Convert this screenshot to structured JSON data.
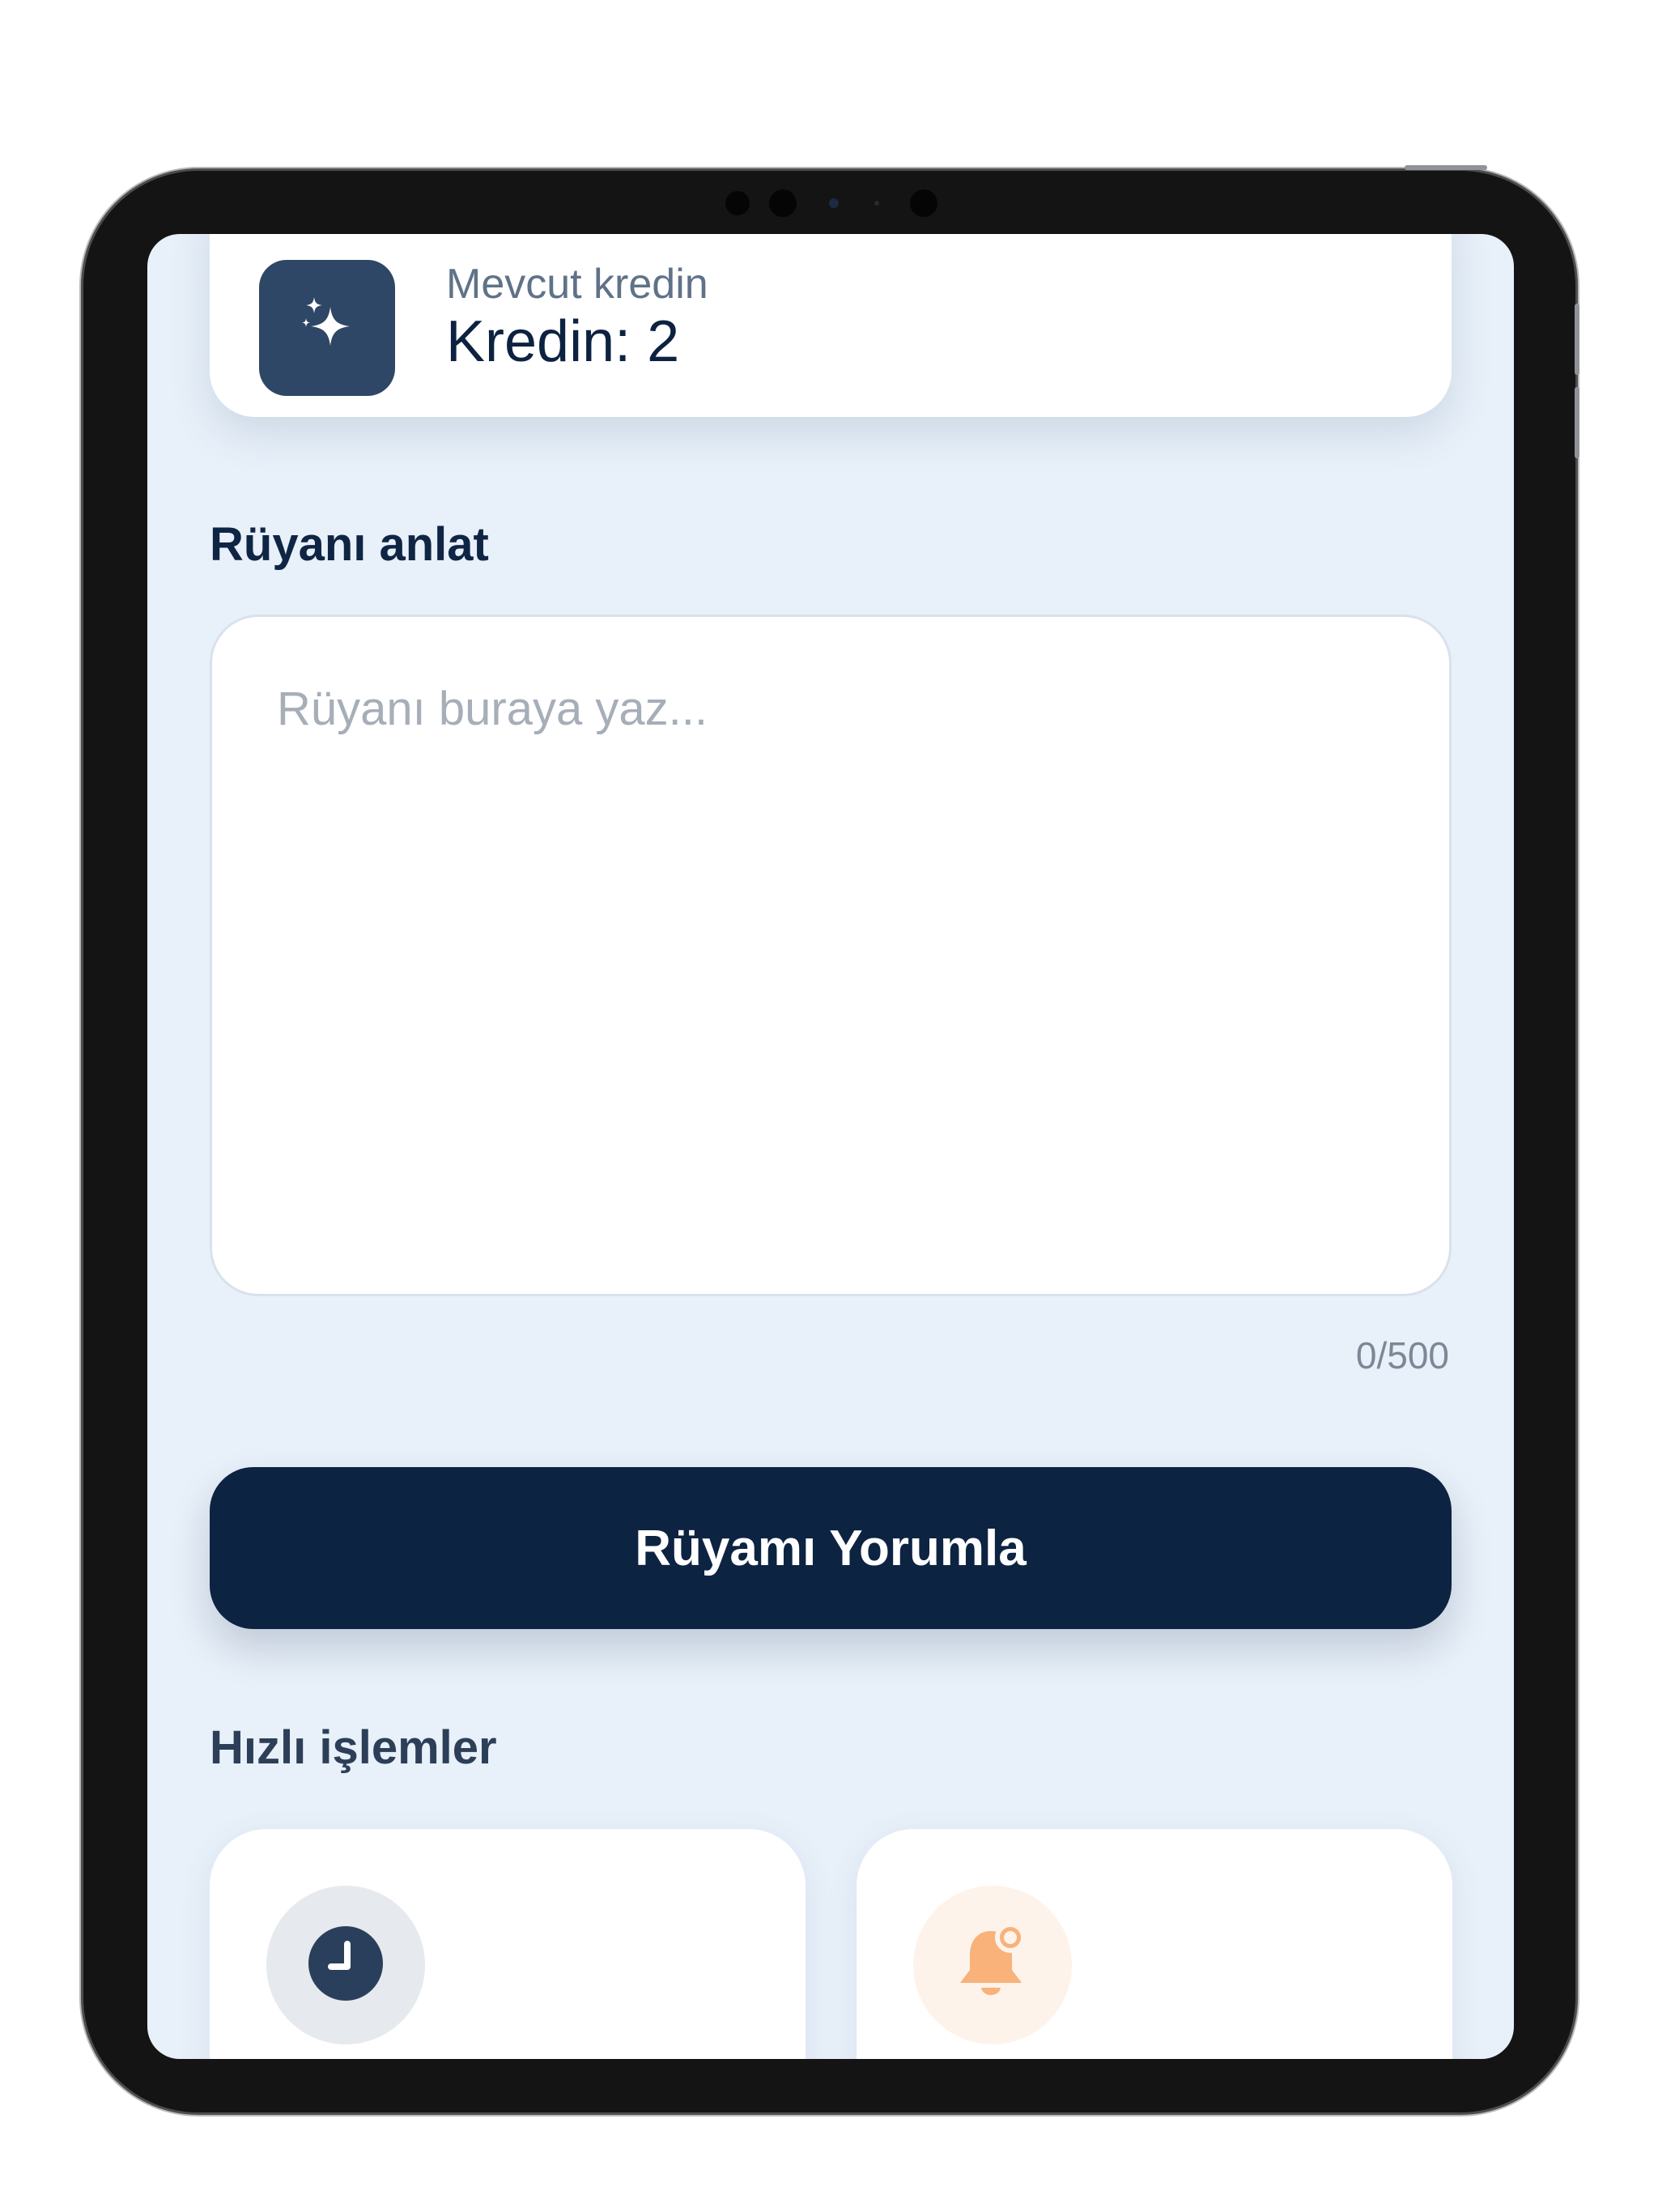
{
  "credit": {
    "label": "Mevcut kredin",
    "value": "Kredin: 2",
    "icon": "sparkles-icon"
  },
  "dream": {
    "section_title": "Rüyanı anlat",
    "placeholder": "Rüyanı buraya yaz...",
    "value": "",
    "char_count": "0/500"
  },
  "actions": {
    "interpret_button": "Rüyamı Yorumla"
  },
  "quick": {
    "section_title": "Hızlı işlemler",
    "cards": [
      {
        "icon": "clock-icon"
      },
      {
        "icon": "bell-notification-icon"
      }
    ]
  },
  "colors": {
    "primary": "#0d2342",
    "icon_box": "#2f4766",
    "background": "#e8f0f9",
    "bell_accent": "#f8b27a"
  }
}
